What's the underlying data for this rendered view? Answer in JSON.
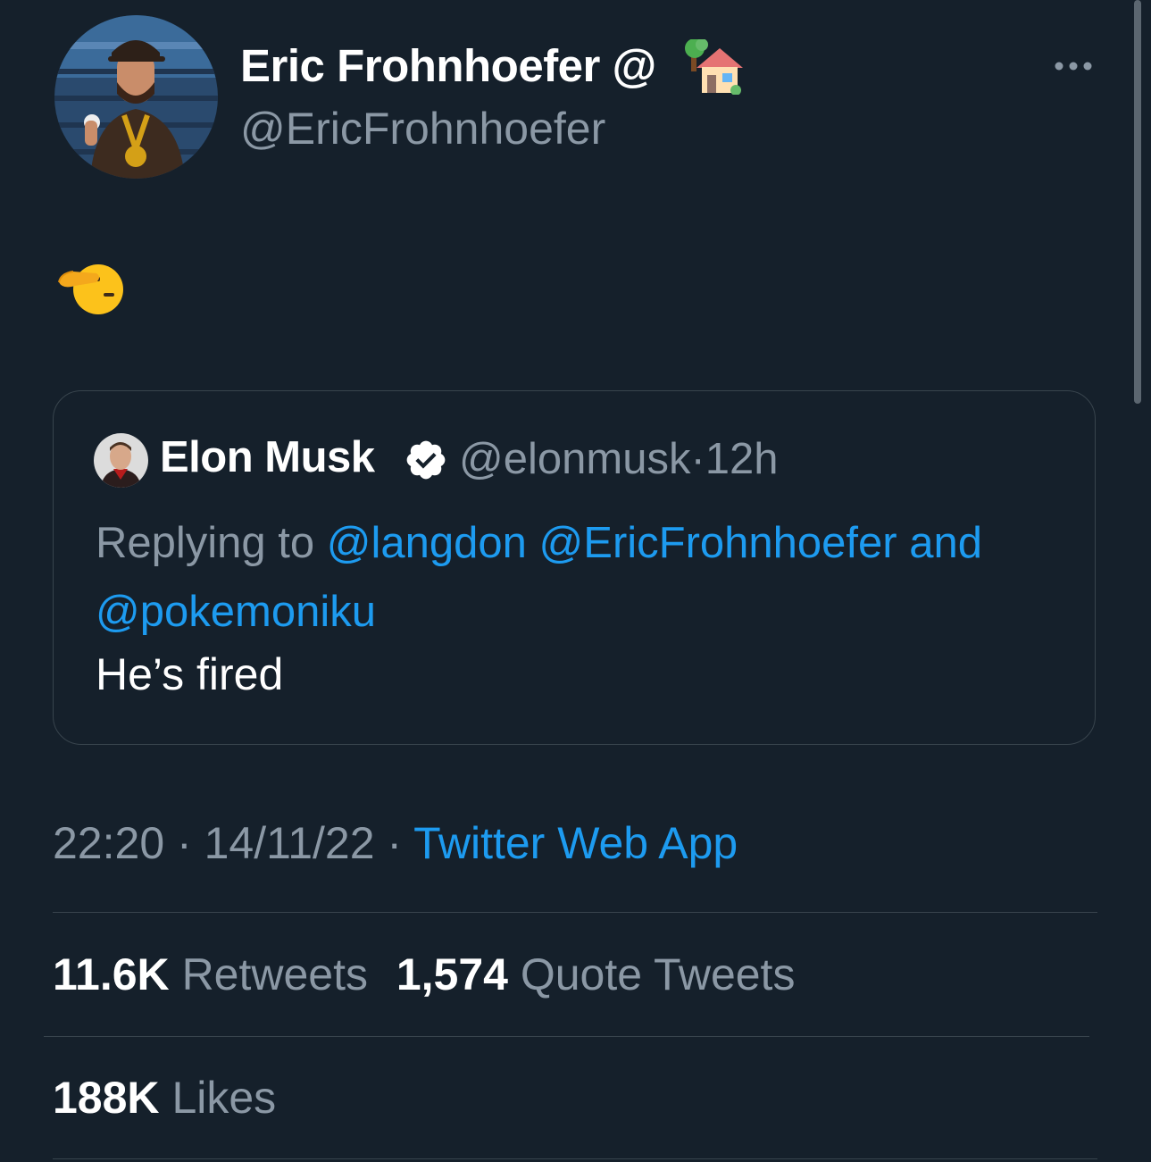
{
  "tweet": {
    "author": {
      "name": "Eric Frohnhoefer @",
      "handle": "@EricFrohnhoefer",
      "name_emoji_icon": "house-with-garden-icon"
    },
    "more_icon": "ellipsis-icon",
    "body_emoji_icon": "saluting-face-icon"
  },
  "quote": {
    "author_name": "Elon Musk",
    "verified_icon": "verified-badge-icon",
    "handle": "@elonmusk",
    "separator": "·",
    "time": "12h",
    "replying_prefix": "Replying to ",
    "mentions": [
      "@langdon",
      "@EricFrohnhoefer",
      "and",
      "@pokemoniku"
    ],
    "text": "He’s fired"
  },
  "meta": {
    "time": "22:20",
    "date": "14/11/22",
    "separator": "·",
    "source": "Twitter Web App"
  },
  "stats": {
    "retweets_count": "11.6K",
    "retweets_label": "Retweets",
    "quotes_count": "1,574",
    "quotes_label": "Quote Tweets",
    "likes_count": "188K",
    "likes_label": "Likes"
  },
  "colors": {
    "background": "#15202b",
    "text_primary": "#ffffff",
    "text_secondary": "#8b98a5",
    "link": "#1d9bf0",
    "border": "#38444d"
  }
}
